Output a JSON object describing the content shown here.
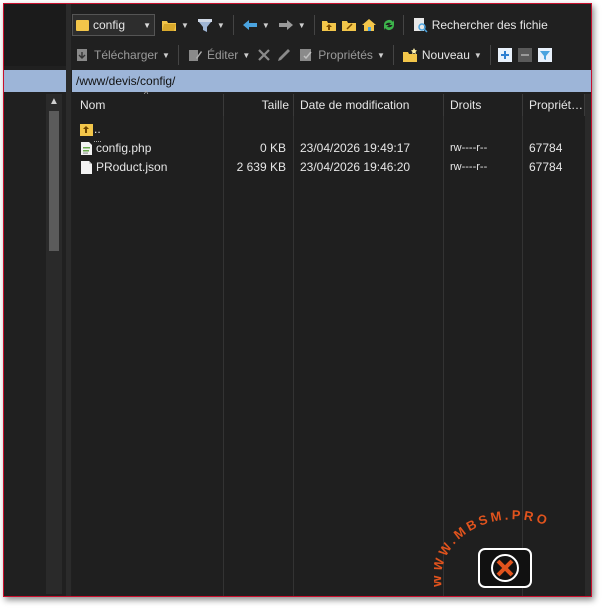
{
  "toolbar_top": {
    "location": "config",
    "search_label": "Rechercher des fichie"
  },
  "toolbar_second": {
    "download": "Télécharger",
    "edit": "Éditer",
    "properties": "Propriétés",
    "new": "Nouveau"
  },
  "path": "/www/devis/config/",
  "columns": [
    "Nom",
    "Taille",
    "Date de modification",
    "Droits",
    "Propriét…"
  ],
  "rows": [
    {
      "name": "..",
      "size": "",
      "date": "",
      "rights": "",
      "owner": "",
      "icon": "folder-up-icon"
    },
    {
      "name": "config.php",
      "size": "0 KB",
      "date": "23/04/2026 19:49:17",
      "rights": "rw----r--",
      "owner": "67784",
      "icon": "php-file-icon"
    },
    {
      "name": "PRoduct.json",
      "size": "2 639 KB",
      "date": "23/04/2026 19:46:20",
      "rights": "rw----r--",
      "owner": "67784",
      "icon": "json-file-icon"
    }
  ],
  "watermark": "WWW.MBSM.PRO",
  "colors": {
    "background": "#202020",
    "path_bar": "#9db5d8",
    "folder": "#f3c64a",
    "accent_blue": "#4aa3df",
    "green_refresh": "#3cb44b",
    "frame_border": "#c8102e"
  }
}
